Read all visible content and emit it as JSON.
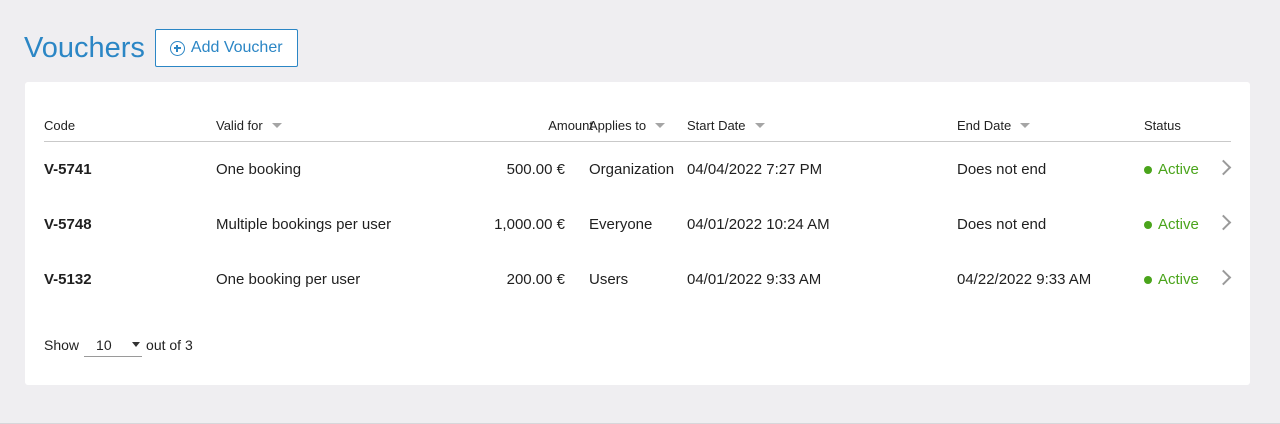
{
  "header": {
    "title": "Vouchers",
    "add_label": "Add Voucher"
  },
  "table": {
    "columns": {
      "code": "Code",
      "valid_for": "Valid for",
      "amount": "Amount",
      "applies_to": "Applies to",
      "start_date": "Start Date",
      "end_date": "End Date",
      "status": "Status"
    },
    "rows": [
      {
        "code": "V-5741",
        "valid_for": "One booking",
        "amount": "500.00 €",
        "applies_to": "Organization",
        "start_date": "04/04/2022 7:27 PM",
        "end_date": "Does not end",
        "status": "Active"
      },
      {
        "code": "V-5748",
        "valid_for": "Multiple bookings per user",
        "amount": "1,000.00 €",
        "applies_to": "Everyone",
        "start_date": "04/01/2022 10:24 AM",
        "end_date": "Does not end",
        "status": "Active"
      },
      {
        "code": "V-5132",
        "valid_for": "One booking per user",
        "amount": "200.00 €",
        "applies_to": "Users",
        "start_date": "04/01/2022 9:33 AM",
        "end_date": "04/22/2022 9:33 AM",
        "status": "Active"
      }
    ]
  },
  "pagination": {
    "show_label": "Show",
    "page_size": "10",
    "total_label": "out of 3"
  },
  "colors": {
    "accent": "#2b86c5",
    "active": "#4aa41b"
  }
}
